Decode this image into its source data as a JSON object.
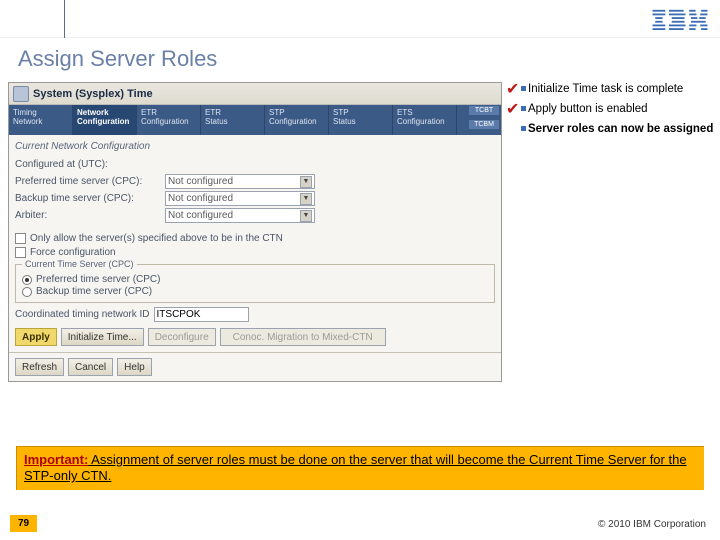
{
  "header": {
    "logo": "IBM"
  },
  "slide": {
    "title": "Assign Server Roles"
  },
  "screenshot": {
    "window_title": "System (Sysplex) Time",
    "tabs": [
      {
        "line1": "Timing",
        "line2": "Network"
      },
      {
        "line1": "Network",
        "line2": "Configuration"
      },
      {
        "line1": "ETR",
        "line2": "Configuration"
      },
      {
        "line1": "ETR",
        "line2": "Status"
      },
      {
        "line1": "STP",
        "line2": "Configuration"
      },
      {
        "line1": "STP",
        "line2": "Status"
      },
      {
        "line1": "ETS",
        "line2": "Configuration"
      }
    ],
    "side_codes": {
      "top": "TCBT",
      "bottom": "TCBM"
    },
    "section_label": "Current Network Configuration",
    "config_at_label": "Configured at (UTC):",
    "rows": {
      "preferred": {
        "label": "Preferred time server (CPC):",
        "value": "Not configured"
      },
      "backup": {
        "label": "Backup time server (CPC):",
        "value": "Not configured"
      },
      "arbiter": {
        "label": "Arbiter:",
        "value": "Not configured"
      }
    },
    "checks": {
      "only_allow": "Only allow the server(s) specified above to be in the CTN",
      "force": "Force configuration"
    },
    "group": {
      "legend": "Current Time Server (CPC)",
      "opt1": "Preferred time server (CPC)",
      "opt2": "Backup time server (CPC)"
    },
    "coord": {
      "label": "Coordinated timing network ID",
      "value": "ITSCPOK"
    },
    "buttons": {
      "apply": "Apply",
      "initialize": "Initialize Time...",
      "deconfigure": "Deconfigure",
      "conoc": "Conoc. Migration to Mixed-CTN"
    },
    "footer": {
      "refresh": "Refresh",
      "cancel": "Cancel",
      "help": "Help"
    }
  },
  "notes": {
    "n1": "Initialize Time task is complete",
    "n2": "Apply button is enabled",
    "n3": "Server roles can now be assigned"
  },
  "important": {
    "label": "Important:",
    "text": " Assignment of server roles must be done on the server that will become the Current Time Server for the STP-only CTN."
  },
  "footer": {
    "page": "79",
    "copyright": "© 2010 IBM Corporation"
  }
}
